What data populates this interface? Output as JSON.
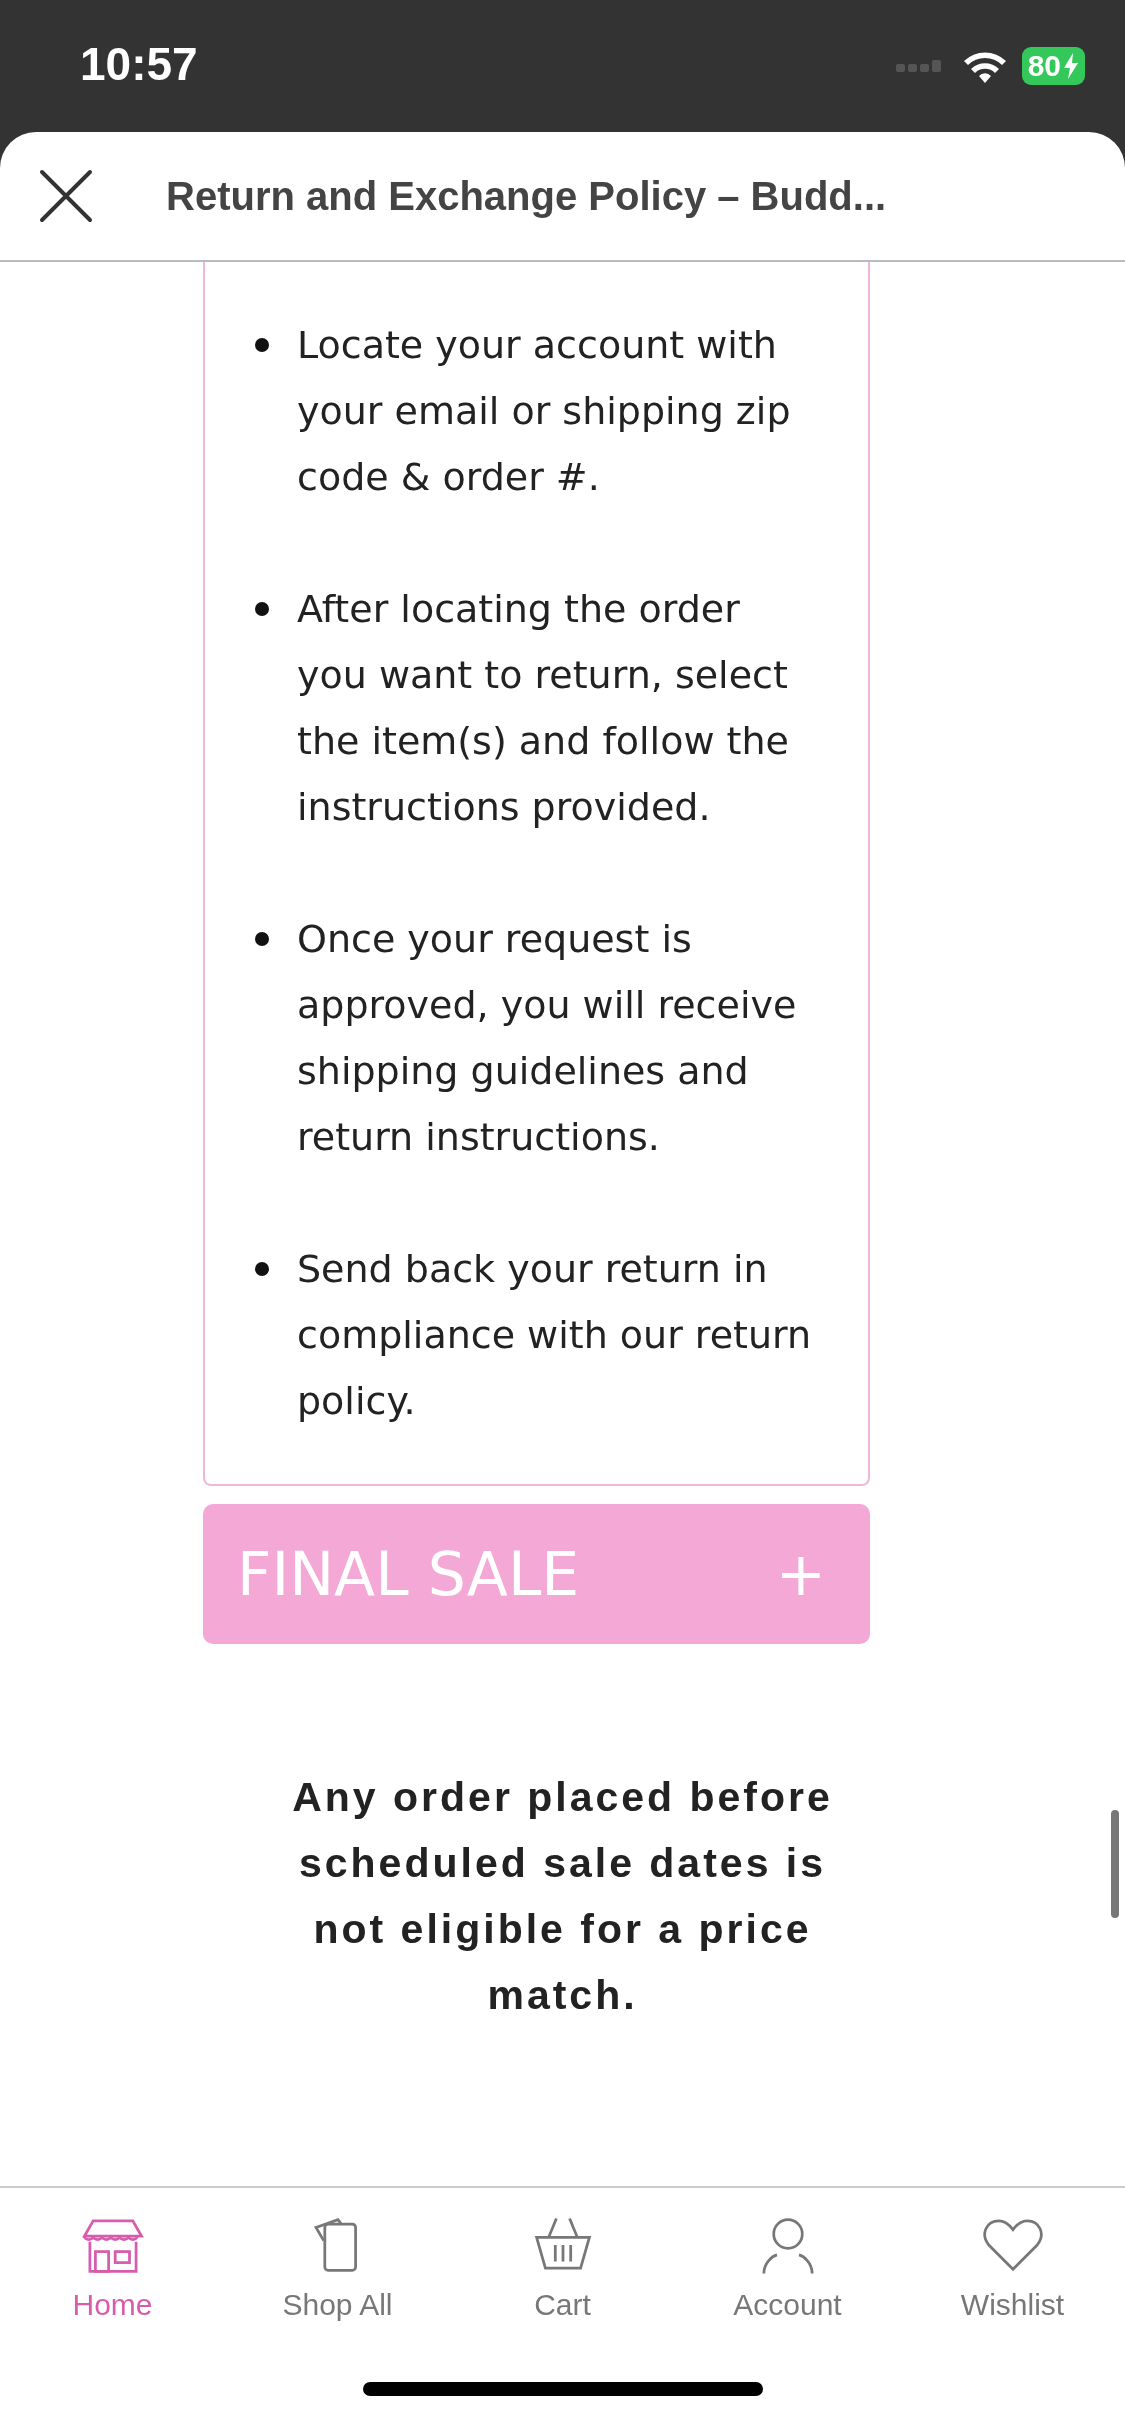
{
  "status_bar": {
    "time": "10:57",
    "battery": "80"
  },
  "header": {
    "title": "Return and Exchange Policy – Budd..."
  },
  "steps": [
    "Locate your account with your email or shipping zip code & order #.",
    "After locating the order you want to return, select the item(s) and follow the instructions provided.",
    "Once your request is approved, you will receive shipping guidelines and return instructions.",
    "Send back your return in compliance with our return policy."
  ],
  "accordion": {
    "label": "FINAL SALE",
    "toggle": "+",
    "expanded": false
  },
  "notice": "Any order placed before scheduled sale dates is not eligible for a price match.",
  "tabs": [
    {
      "label": "Home",
      "kind": "home",
      "selected": true
    },
    {
      "label": "Shop All",
      "kind": "shop",
      "selected": false
    },
    {
      "label": "Cart",
      "kind": "cart",
      "selected": false
    },
    {
      "label": "Account",
      "kind": "account",
      "selected": false
    },
    {
      "label": "Wishlist",
      "kind": "wishlist",
      "selected": false
    }
  ]
}
